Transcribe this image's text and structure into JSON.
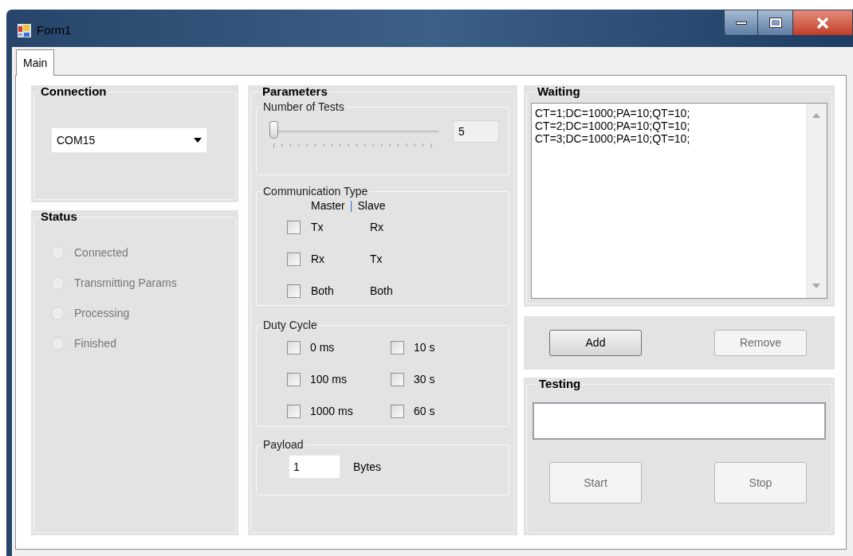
{
  "window": {
    "title": "Form1"
  },
  "tabs": [
    {
      "label": "Main",
      "selected": true
    }
  ],
  "connection": {
    "title": "Connection",
    "port": {
      "value": "COM15"
    }
  },
  "status": {
    "title": "Status",
    "items": [
      {
        "label": "Connected",
        "selected": false,
        "disabled": true
      },
      {
        "label": "Transmitting Params",
        "selected": false,
        "disabled": true
      },
      {
        "label": "Processing",
        "selected": false,
        "disabled": true
      },
      {
        "label": "Finished",
        "selected": false,
        "disabled": true
      }
    ]
  },
  "parameters": {
    "title": "Parameters",
    "number_of_tests": {
      "title": "Number of Tests",
      "level": 0,
      "value": "5"
    },
    "communication_type": {
      "title": "Communication Type",
      "header": {
        "master": "Master",
        "separator": "|",
        "slave": "Slave"
      },
      "rows": [
        {
          "checked": false,
          "master": "Tx",
          "slave": "Rx"
        },
        {
          "checked": false,
          "master": "Rx",
          "slave": "Tx"
        },
        {
          "checked": false,
          "master": "Both",
          "slave": "Both"
        }
      ]
    },
    "duty_cycle": {
      "title": "Duty Cycle",
      "options": [
        {
          "label": "0 ms",
          "checked": false
        },
        {
          "label": "10 s",
          "checked": false
        },
        {
          "label": "100 ms",
          "checked": false
        },
        {
          "label": "30 s",
          "checked": false
        },
        {
          "label": "1000 ms",
          "checked": false
        },
        {
          "label": "60 s",
          "checked": false
        }
      ]
    },
    "payload": {
      "title": "Payload",
      "value": "1",
      "unit": "Bytes"
    }
  },
  "waiting": {
    "title": "Waiting",
    "lines": [
      "CT=1;DC=1000;PA=10;QT=10;",
      "CT=2;DC=1000;PA=10;QT=10;",
      "CT=3;DC=1000;PA=10;QT=10;"
    ]
  },
  "list_buttons": [
    {
      "label": "Add",
      "disabled": false
    },
    {
      "label": "Remove",
      "disabled": true
    }
  ],
  "testing": {
    "title": "Testing",
    "buttons": [
      {
        "label": "Start",
        "disabled": true
      },
      {
        "label": "Stop",
        "disabled": true
      }
    ]
  }
}
